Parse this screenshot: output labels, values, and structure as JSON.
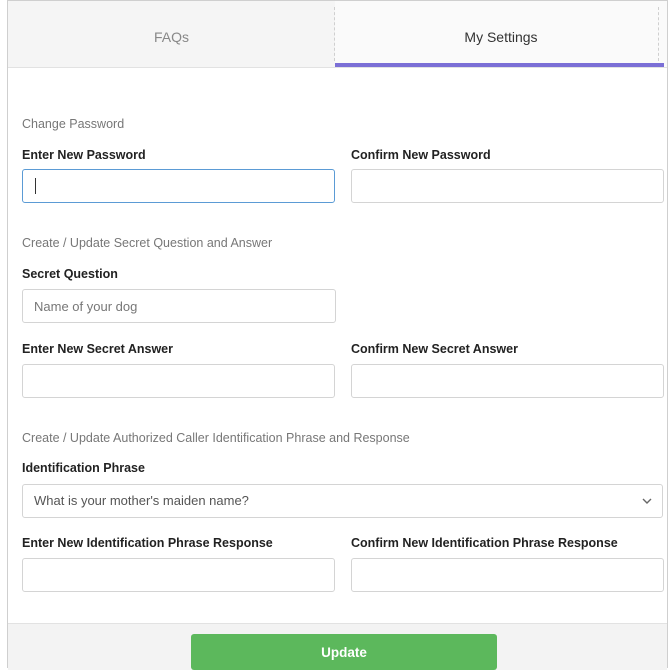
{
  "tabs": [
    {
      "label": "FAQs",
      "active": false
    },
    {
      "label": "My Settings",
      "active": true
    }
  ],
  "colors": {
    "active_tab_accent": "#7b6fd6",
    "update_button": "#5cb85c",
    "focused_border": "#5b9bd5"
  },
  "password": {
    "section_title": "Change Password",
    "new_label": "Enter New Password",
    "new_value": "",
    "confirm_label": "Confirm New Password",
    "confirm_value": ""
  },
  "secret": {
    "section_title": "Create / Update Secret Question and Answer",
    "question_label": "Secret Question",
    "question_placeholder": "Name of your dog",
    "answer_label": "Enter New Secret Answer",
    "answer_value": "",
    "confirm_label": "Confirm New Secret Answer",
    "confirm_value": ""
  },
  "caller_id": {
    "section_title": "Create / Update Authorized Caller Identification Phrase and Response",
    "phrase_label": "Identification Phrase",
    "phrase_selected": "What is your mother's maiden name?",
    "response_label": "Enter New Identification Phrase Response",
    "response_value": "",
    "confirm_label": "Confirm New Identification Phrase Response",
    "confirm_value": ""
  },
  "footer": {
    "update_label": "Update"
  },
  "icons": {
    "dropdown": "chevron-down-icon"
  }
}
